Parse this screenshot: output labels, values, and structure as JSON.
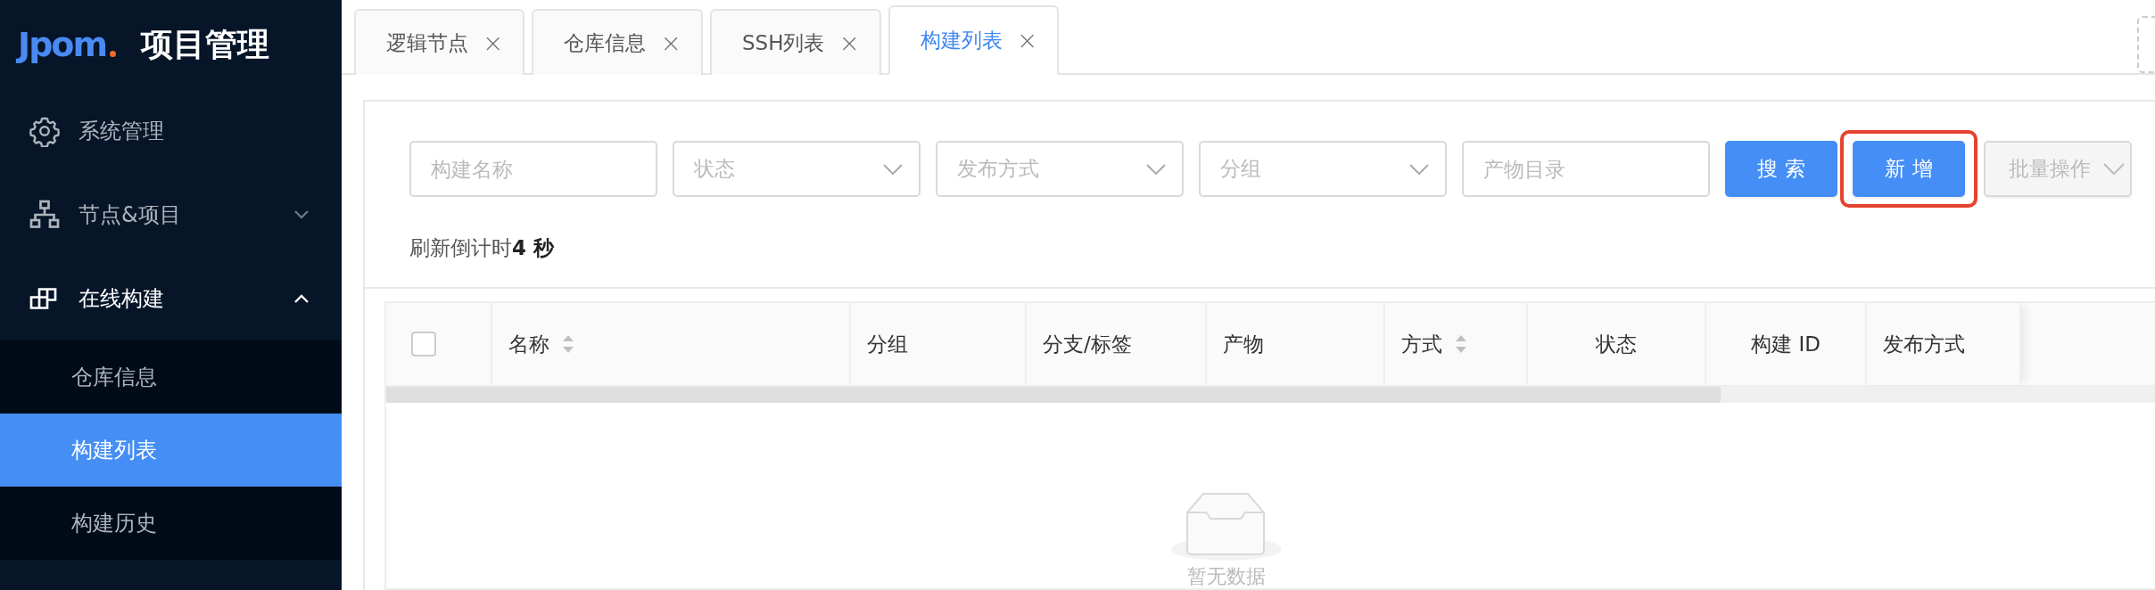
{
  "sidebar": {
    "logo": "Jpom",
    "title": "项目管理",
    "items": [
      {
        "label": "系统管理",
        "kind": "link"
      },
      {
        "label": "节点&项目",
        "kind": "group",
        "expanded": false
      },
      {
        "label": "在线构建",
        "kind": "group",
        "expanded": true,
        "children": [
          {
            "label": "仓库信息",
            "selected": false
          },
          {
            "label": "构建列表",
            "selected": true
          },
          {
            "label": "构建历史",
            "selected": false
          }
        ]
      }
    ]
  },
  "tabs": [
    {
      "label": "逻辑节点",
      "selected": false,
      "close": "×"
    },
    {
      "label": "仓库信息",
      "selected": false,
      "close": "×"
    },
    {
      "label": "SSH列表",
      "selected": false,
      "close": "×"
    },
    {
      "label": "构建列表",
      "selected": true,
      "close": "×"
    }
  ],
  "filters": [
    {
      "kind": "input",
      "placeholder": "构建名称"
    },
    {
      "kind": "select",
      "placeholder": "状态"
    },
    {
      "kind": "select",
      "placeholder": "发布方式"
    },
    {
      "kind": "select",
      "placeholder": "分组"
    },
    {
      "kind": "input",
      "placeholder": "产物目录"
    }
  ],
  "buttons": [
    {
      "label": "搜索",
      "kind": "primary"
    },
    {
      "label": "新增",
      "kind": "primary",
      "highlighted": true
    },
    {
      "label": "批量操作",
      "kind": "dropdown",
      "disabled": true
    }
  ],
  "countdown": "刷新倒计时**4 秒**",
  "table": {
    "select_all": {
      "checked": false
    },
    "columns": [
      {
        "label": "名称",
        "sortable": true
      },
      {
        "label": "分组",
        "sortable": false
      },
      {
        "label": "分支/标签",
        "sortable": false
      },
      {
        "label": "产物",
        "sortable": false
      },
      {
        "label": "方式",
        "sortable": true
      },
      {
        "label": "状态",
        "sortable": false
      },
      {
        "label": "构建 ID",
        "sortable": false
      },
      {
        "label": "发布方式",
        "sortable": false
      }
    ],
    "empty": "暂无数据"
  }
}
